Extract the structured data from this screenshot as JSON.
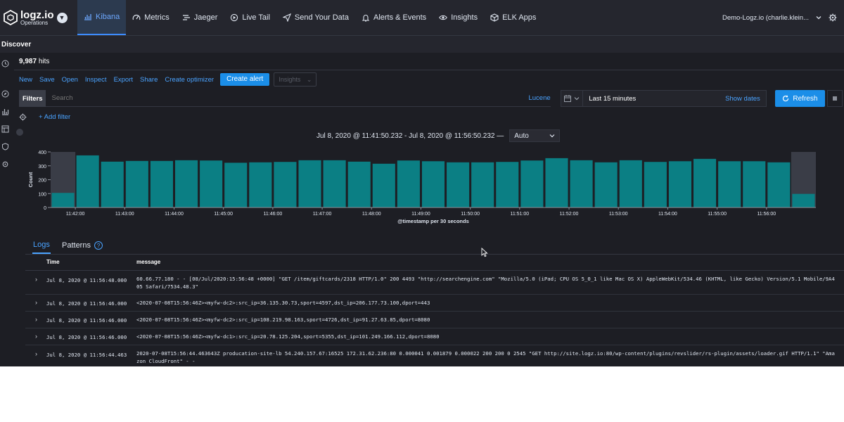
{
  "app": {
    "logo_name": "logz.io",
    "logo_sub": "Operations",
    "nav": [
      {
        "label": "Kibana",
        "icon": "bar-chart-icon",
        "active": true
      },
      {
        "label": "Metrics",
        "icon": "gauge-icon",
        "active": false
      },
      {
        "label": "Jaeger",
        "icon": "tracing-icon",
        "active": false
      },
      {
        "label": "Live Tail",
        "icon": "live-tail-icon",
        "active": false
      },
      {
        "label": "Send Your Data",
        "icon": "send-icon",
        "active": false
      },
      {
        "label": "Alerts & Events",
        "icon": "bell-icon",
        "active": false
      },
      {
        "label": "Insights",
        "icon": "eye-icon",
        "active": false
      },
      {
        "label": "ELK Apps",
        "icon": "cube-icon",
        "active": false
      }
    ],
    "account": "Demo-Logz.io (charlie.klein...",
    "accent": "#1b8ee8"
  },
  "discover": {
    "title": "Discover",
    "hits_count": "9,987",
    "hits_label": "hits",
    "toolbar": [
      "New",
      "Save",
      "Open",
      "Inspect",
      "Export",
      "Share",
      "Create optimizer"
    ],
    "create_alert": "Create alert",
    "insights": "Insights",
    "filters_label": "Filters",
    "search_placeholder": "Search",
    "lucene": "Lucene",
    "time_range": "Last 15 minutes",
    "show_dates": "Show dates",
    "refresh": "Refresh",
    "add_filter": "+ Add filter"
  },
  "chart_header": {
    "range": "Jul 8, 2020 @ 11:41:50.232 - Jul 8, 2020 @ 11:56:50.232 —",
    "interval": "Auto"
  },
  "chart_data": {
    "type": "bar",
    "ylabel": "Count",
    "xlabel": "@timestamp per 30 seconds",
    "ylim": [
      0,
      400
    ],
    "yticks": [
      0,
      100,
      200,
      300,
      400
    ],
    "xticks": [
      "11:42:00",
      "11:43:00",
      "11:44:00",
      "11:45:00",
      "11:46:00",
      "11:47:00",
      "11:48:00",
      "11:49:00",
      "11:50:00",
      "11:51:00",
      "11:52:00",
      "11:53:00",
      "11:54:00",
      "11:55:00",
      "11:56:00"
    ],
    "values": [
      105,
      375,
      330,
      335,
      335,
      340,
      338,
      322,
      325,
      328,
      340,
      340,
      330,
      315,
      338,
      333,
      325,
      325,
      328,
      338,
      355,
      340,
      325,
      340,
      328,
      333,
      350,
      333,
      333,
      325,
      98
    ],
    "bar_color": "#0b7f84",
    "partial_color": "#3a3d47"
  },
  "tabs": {
    "logs": "Logs",
    "patterns": "Patterns",
    "help": "?"
  },
  "table": {
    "columns": [
      "Time",
      "message"
    ],
    "rows": [
      {
        "time": "Jul 8, 2020 @ 11:56:48.000",
        "message": "60.66.77.180 - - [08/Jul/2020:15:56:48 +0000] \"GET /item/giftcards/2318 HTTP/1.0\" 200 4493 \"http://searchengine.com\" \"Mozilla/5.0 (iPad; CPU OS 5_0_1 like Mac OS X) AppleWebKit/534.46 (KHTML, like Gecko) Version/5.1 Mobile/9A405 Safari/7534.48.3\""
      },
      {
        "time": "Jul 8, 2020 @ 11:56:46.000",
        "message": "<2020-07-08T15:56:46Z><myfw-dc2>:src_ip=36.135.30.73,sport=4597,dst_ip=206.177.73.100,dport=443"
      },
      {
        "time": "Jul 8, 2020 @ 11:56:46.000",
        "message": "<2020-07-08T15:56:46Z><myfw-dc2>:src_ip=108.219.98.163,sport=4726,dst_ip=91.27.63.85,dport=8080"
      },
      {
        "time": "Jul 8, 2020 @ 11:56:46.000",
        "message": "<2020-07-08T15:56:46Z><myfw-dc1>:src_ip=20.78.125.204,sport=5355,dst_ip=101.249.166.112,dport=8080"
      },
      {
        "time": "Jul 8, 2020 @ 11:56:44.463",
        "message": "2020-07-08T15:56:44.463643Z producation-site-lb 54.240.157.67:16525 172.31.62.236:80 0.000041 0.001879 0.000022 200 200 0 2545 \"GET http://site.logz.io:80/wp-content/plugins/revslider/rs-plugin/assets/loader.gif HTTP/1.1\" \"Amazon CloudFront\" - -"
      }
    ]
  }
}
